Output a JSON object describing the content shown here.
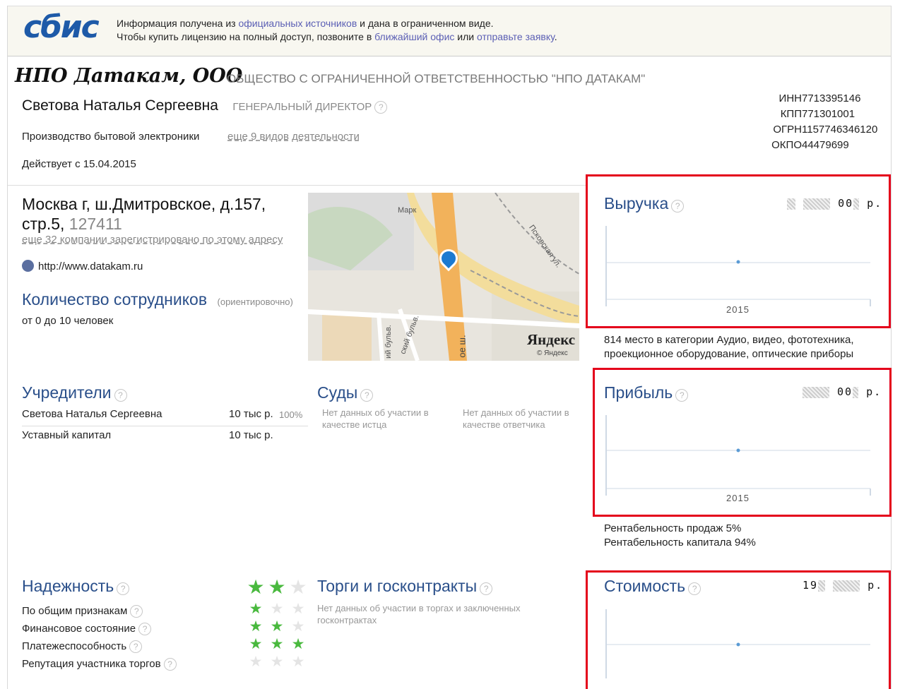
{
  "banner": {
    "logo": "сбис",
    "line1": {
      "pre": "Информация получена из ",
      "link": "официальных источников",
      "post": " и дана в ограниченном виде."
    },
    "line2": {
      "pre": "Чтобы купить лицензию на полный доступ, позвоните в ",
      "link1": "ближайший офис",
      "mid": " или ",
      "link2": "отправьте заявку",
      "post": "."
    }
  },
  "company": {
    "short_name": "НПО Датакам, ООО",
    "full_name": "ОБЩЕСТВО С ОГРАНИЧЕННОЙ ОТВЕТСТВЕННОСТЬЮ \"НПО ДАТАКАМ\"",
    "director_name": "Светова Наталья Сергеевна",
    "director_role": "ГЕНЕРАЛЬНЫЙ ДИРЕКТОР",
    "activity": "Производство бытовой электроники",
    "more_activities": "еще 9 видов деятельности",
    "active_since": "Действует с 15.04.2015"
  },
  "registry": {
    "inn_label": "ИНН",
    "inn": "7713395146",
    "kpp_label": "КПП",
    "kpp": "771301001",
    "ogrn_label": "ОГРН",
    "ogrn": "1157746346120",
    "okpo_label": "ОКПО",
    "okpo": "44479699"
  },
  "address": {
    "line1": "Москва г, ш.Дмитровское, д.157,",
    "line2": "стр.5,",
    "zip": "127411",
    "same_address": "еще 32 компании зарегистрировано по этому адресу",
    "website": "http://www.datakam.ru"
  },
  "employees": {
    "title": "Количество сотрудников",
    "note": "(ориентировочно)",
    "value": "от 0 до 10 человек"
  },
  "map": {
    "label_mark": "Марк",
    "label_street": "Псковская ул.",
    "label_shosse": "ое ш.",
    "label_bulvar1": "ий бульв.",
    "label_bulvar2": "ский бульв.",
    "brand": "Яндекс",
    "copyright": "© Яндекс"
  },
  "founders": {
    "title": "Учредители",
    "rows": [
      {
        "name": "Светова Наталья Сергеевна",
        "amount": "10 тыс р.",
        "share": "100%"
      },
      {
        "name": "Уставный капитал",
        "amount": "10 тыс р.",
        "share": ""
      }
    ]
  },
  "courts": {
    "title": "Суды",
    "plaintiff": "Нет данных об участии в качестве истца",
    "defendant": "Нет данных об участии в качестве ответчика"
  },
  "reliability": {
    "title": "Надежность",
    "overall_stars": 2,
    "rows": [
      {
        "label": "По общим признакам",
        "stars": 1
      },
      {
        "label": "Финансовое состояние",
        "stars": 2
      },
      {
        "label": "Платежеспособность",
        "stars": 3
      },
      {
        "label": "Репутация участника торгов",
        "stars": 0
      }
    ]
  },
  "tenders": {
    "title": "Торги и госконтракты",
    "text": "Нет данных об участии в торгах и заключенных госконтрактах"
  },
  "finance": {
    "revenue": {
      "title": "Выручка",
      "value_visible": "00",
      "currency": "р.",
      "year": "2015"
    },
    "revenue_note": "814 место в категории Аудио, видео, фототехника, проекционное оборудование, оптические приборы",
    "profit": {
      "title": "Прибыль",
      "value_visible": "00",
      "currency": "р.",
      "year": "2015"
    },
    "profitability_sales": "Рентабельность продаж 5%",
    "profitability_capital": "Рентабельность капитала 94%",
    "cost": {
      "title": "Стоимость",
      "value_visible": "19",
      "currency": "р."
    }
  },
  "colors": {
    "accent": "#2a4f8a",
    "highlight": "#e4001b",
    "star": "#49b93e"
  }
}
